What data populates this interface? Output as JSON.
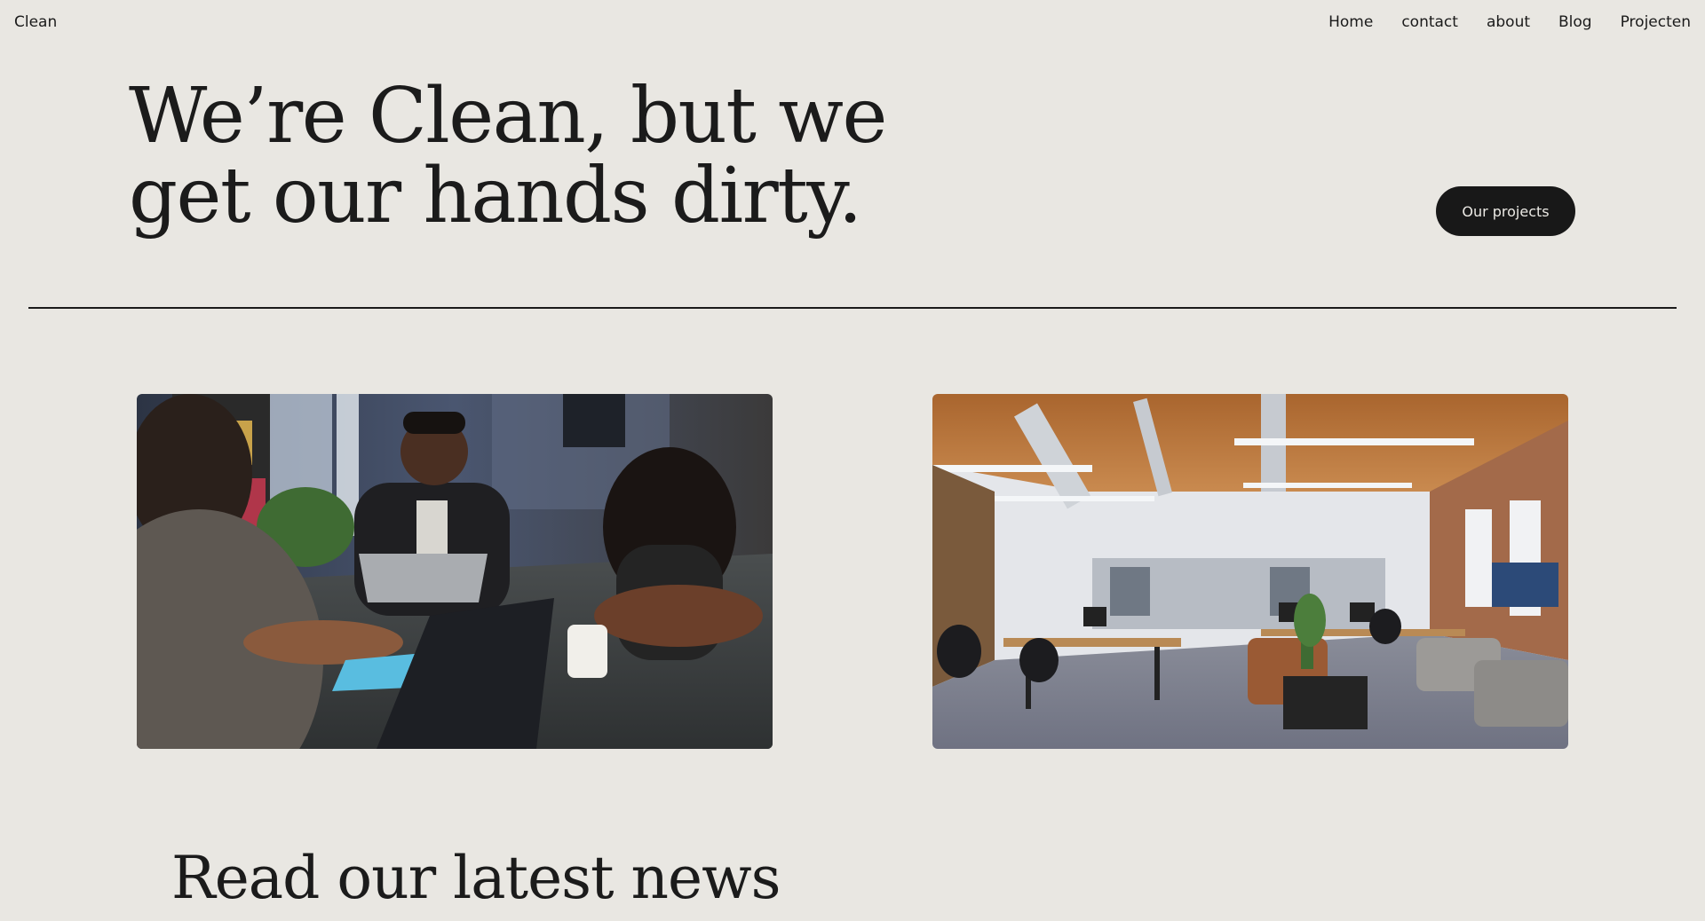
{
  "header": {
    "brand": "Clean",
    "nav": [
      "Home",
      "contact",
      "about",
      "Blog",
      "Projecten"
    ]
  },
  "hero": {
    "title_line1": "We’re Clean, but we",
    "title_line2": "get our hands dirty.",
    "cta_label": "Our projects"
  },
  "gallery": {
    "images": [
      {
        "name": "team-meeting-photo",
        "alt": "Team meeting around a table with laptops"
      },
      {
        "name": "open-office-photo",
        "alt": "Open-plan office with desks and lounge seating"
      }
    ]
  },
  "news": {
    "title": "Read our latest news"
  },
  "colors": {
    "background": "#e9e7e2",
    "text": "#1b1b1b",
    "button_bg": "#181818",
    "button_text": "#ebe9e4"
  }
}
